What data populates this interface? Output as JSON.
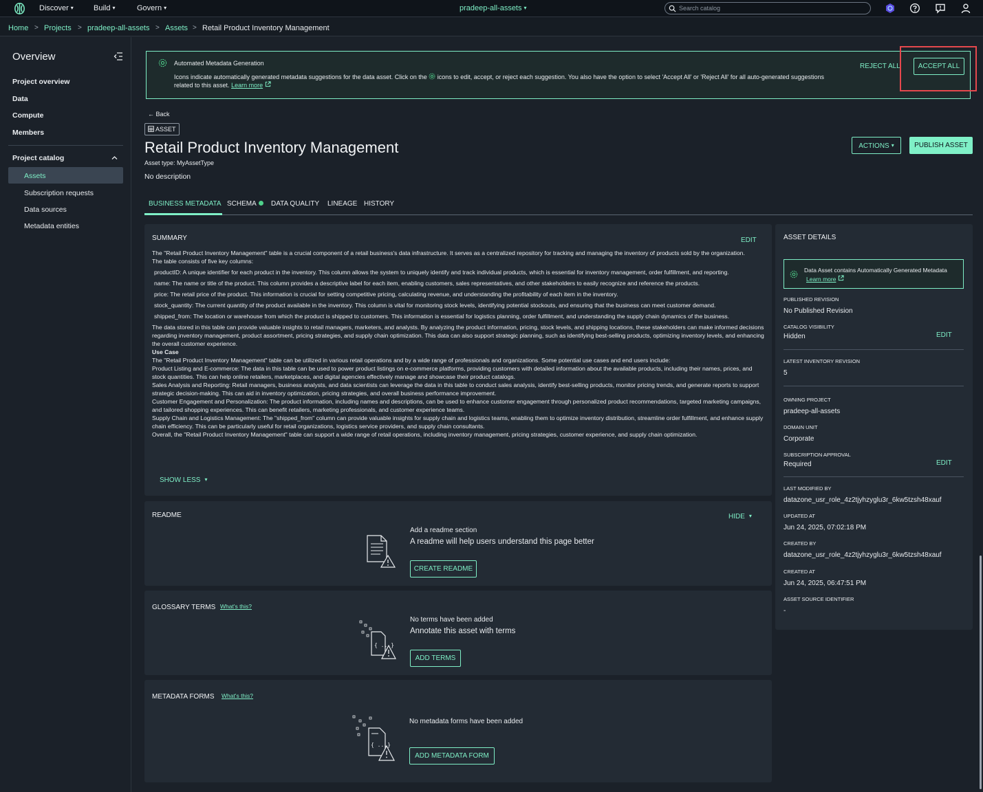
{
  "topbar": {
    "nav": [
      "Discover",
      "Build",
      "Govern"
    ],
    "project": "pradeep-all-assets",
    "search_placeholder": "Search catalog"
  },
  "breadcrumb": [
    "Home",
    "Projects",
    "pradeep-all-assets",
    "Assets",
    "Retail Product Inventory Management"
  ],
  "sidebar": {
    "title": "Overview",
    "items": [
      "Project overview",
      "Data",
      "Compute",
      "Members"
    ],
    "section": "Project catalog",
    "sub_items": [
      "Assets",
      "Subscription requests",
      "Data sources",
      "Metadata entities"
    ]
  },
  "banner": {
    "title": "Automated Metadata Generation",
    "text_before": "Icons indicate automatically generated metadata suggestions for the data asset. Click on the",
    "text_after": "icons to edit, accept, or reject each suggestion. You also have the option to select 'Accept All' or 'Reject All' for all auto-generated suggestions related to this asset.",
    "learn_more": "Learn more",
    "reject_all": "REJECT ALL",
    "accept_all": "ACCEPT ALL"
  },
  "asset": {
    "back": "Back",
    "tag": "ASSET",
    "title": "Retail Product Inventory Management",
    "type_label": "Asset type: MyAssetType",
    "description": "No description",
    "actions_label": "ACTIONS",
    "publish_label": "PUBLISH ASSET"
  },
  "tabs": [
    "BUSINESS METADATA",
    "SCHEMA",
    "DATA QUALITY",
    "LINEAGE",
    "HISTORY"
  ],
  "summary": {
    "title": "SUMMARY",
    "edit": "EDIT",
    "intro": "The \"Retail Product Inventory Management\" table is a crucial component of a retail business's data infrastructure. It serves as a centralized repository for tracking and managing the inventory of products sold by the organization.",
    "columns_intro": "The table consists of five key columns:",
    "columns": [
      "productID: A unique identifier for each product in the inventory. This column allows the system to uniquely identify and track individual products, which is essential for inventory management, order fulfillment, and reporting.",
      "name: The name or title of the product. This column provides a descriptive label for each item, enabling customers, sales representatives, and other stakeholders to easily recognize and reference the products.",
      "price: The retail price of the product. This information is crucial for setting competitive pricing, calculating revenue, and understanding the profitability of each item in the inventory.",
      "stock_quantity: The current quantity of the product available in the inventory. This column is vital for monitoring stock levels, identifying potential stockouts, and ensuring that the business can meet customer demand.",
      "shipped_from: The location or warehouse from which the product is shipped to customers. This information is essential for logistics planning, order fulfillment, and understanding the supply chain dynamics of the business."
    ],
    "insights": "The data stored in this table can provide valuable insights to retail managers, marketers, and analysts. By analyzing the product information, pricing, stock levels, and shipping locations, these stakeholders can make informed decisions regarding inventory management, product assortment, pricing strategies, and supply chain optimization. This data can also support strategic planning, such as identifying best-selling products, optimizing inventory levels, and enhancing the overall customer experience.",
    "use_case_heading": "Use Case",
    "use_cases": [
      "The \"Retail Product Inventory Management\" table can be utilized in various retail operations and by a wide range of professionals and organizations. Some potential use cases and end users include:",
      "Product Listing and E-commerce: The data in this table can be used to power product listings on e-commerce platforms, providing customers with detailed information about the available products, including their names, prices, and stock quantities. This can help online retailers, marketplaces, and digital agencies effectively manage and showcase their product catalogs.",
      "Sales Analysis and Reporting: Retail managers, business analysts, and data scientists can leverage the data in this table to conduct sales analysis, identify best-selling products, monitor pricing trends, and generate reports to support strategic decision-making. This can aid in inventory optimization, pricing strategies, and overall business performance improvement.",
      "Customer Engagement and Personalization: The product information, including names and descriptions, can be used to enhance customer engagement through personalized product recommendations, targeted marketing campaigns, and tailored shopping experiences. This can benefit retailers, marketing professionals, and customer experience teams.",
      "Supply Chain and Logistics Management: The \"shipped_from\" column can provide valuable insights for supply chain and logistics teams, enabling them to optimize inventory distribution, streamline order fulfillment, and enhance supply chain efficiency. This can be particularly useful for retail organizations, logistics service providers, and supply chain consultants.",
      "Overall, the \"Retail Product Inventory Management\" table can support a wide range of retail operations, including inventory management, pricing strategies, customer experience, and supply chain optimization."
    ],
    "show_less": "SHOW LESS"
  },
  "readme": {
    "title": "README",
    "hide": "HIDE",
    "line1": "Add a readme section",
    "line2": "A readme will help users understand this page better",
    "button": "CREATE README"
  },
  "glossary": {
    "title": "GLOSSARY TERMS",
    "whats": "What's this?",
    "line1": "No terms have been added",
    "line2": "Annotate this asset with terms",
    "button": "ADD TERMS"
  },
  "forms": {
    "title": "METADATA FORMS",
    "whats": "What's this?",
    "line1": "No metadata forms have been added",
    "button": "ADD METADATA FORM"
  },
  "details": {
    "title": "ASSET DETAILS",
    "notice": "Data Asset contains Automatically Generated Metadata",
    "notice_link": "Learn more",
    "published_revision_label": "PUBLISHED REVISION",
    "published_revision": "No Published Revision",
    "visibility_label": "CATALOG VISIBILITY",
    "visibility": "Hidden",
    "edit": "EDIT",
    "latest_revision_label": "LATEST INVENTORY REVISION",
    "latest_revision": "5",
    "owning_project_label": "OWNING PROJECT",
    "owning_project": "pradeep-all-assets",
    "domain_unit_label": "DOMAIN UNIT",
    "domain_unit": "Corporate",
    "subscription_label": "SUBSCRIPTION APPROVAL",
    "subscription": "Required",
    "modified_by_label": "LAST MODIFIED BY",
    "modified_by": "datazone_usr_role_4z2tjyhzyglu3r_6kw5tzsh48xauf",
    "updated_at_label": "UPDATED AT",
    "updated_at": "Jun 24, 2025, 07:02:18 PM",
    "created_by_label": "CREATED BY",
    "created_by": "datazone_usr_role_4z2tjyhzyglu3r_6kw5tzsh48xauf",
    "created_at_label": "CREATED AT",
    "created_at": "Jun 24, 2025, 06:47:51 PM",
    "source_id_label": "ASSET SOURCE IDENTIFIER",
    "source_id": "-"
  },
  "colors": {
    "accent": "#7ff0c7",
    "highlight": "#e5484d",
    "background": "#1b2129"
  }
}
